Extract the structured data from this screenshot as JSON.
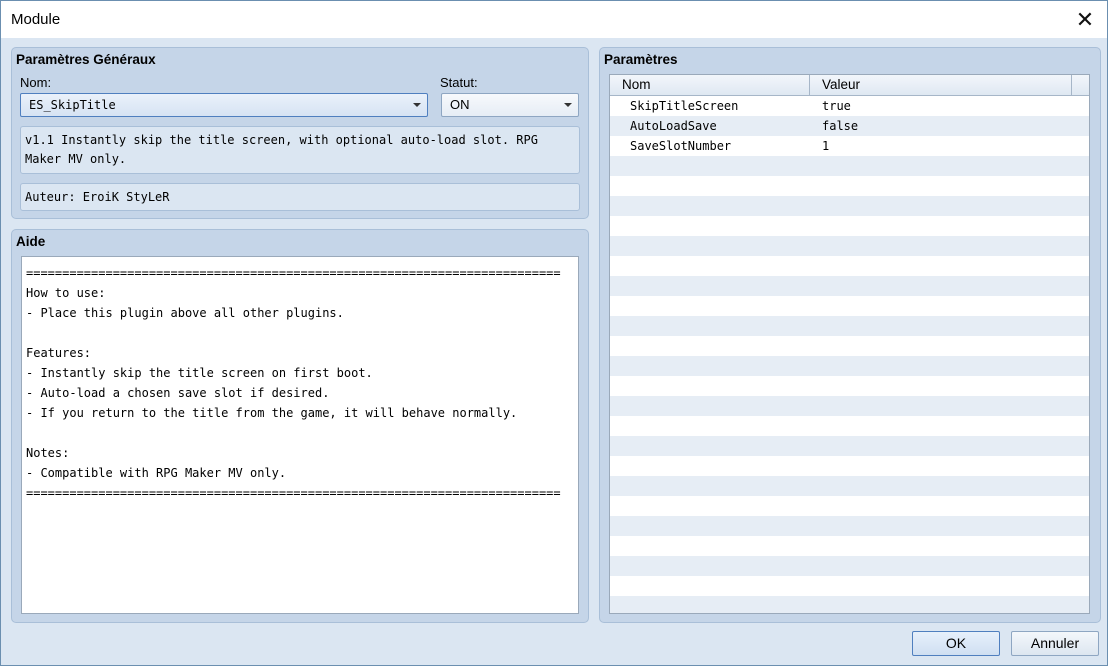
{
  "window": {
    "title": "Module",
    "close_symbol": "✕"
  },
  "general": {
    "title": "Paramètres Généraux",
    "name_label": "Nom:",
    "name_value": "ES_SkipTitle",
    "status_label": "Statut:",
    "status_value": "ON",
    "description": "v1.1 Instantly skip the title screen, with optional auto-load slot. RPG Maker MV only.",
    "author": "Auteur: EroiK StyLeR"
  },
  "help": {
    "title": "Aide",
    "text": "==========================================================================\nHow to use:\n- Place this plugin above all other plugins.\n\nFeatures:\n- Instantly skip the title screen on first boot.\n- Auto-load a chosen save slot if desired.\n- If you return to the title from the game, it will behave normally.\n\nNotes:\n- Compatible with RPG Maker MV only.\n=========================================================================="
  },
  "parameters": {
    "title": "Paramètres",
    "col_name": "Nom",
    "col_value": "Valeur",
    "rows": [
      {
        "name": "SkipTitleScreen",
        "value": "true"
      },
      {
        "name": "AutoLoadSave",
        "value": "false"
      },
      {
        "name": "SaveSlotNumber",
        "value": "1"
      }
    ]
  },
  "buttons": {
    "ok": "OK",
    "cancel": "Annuler"
  }
}
